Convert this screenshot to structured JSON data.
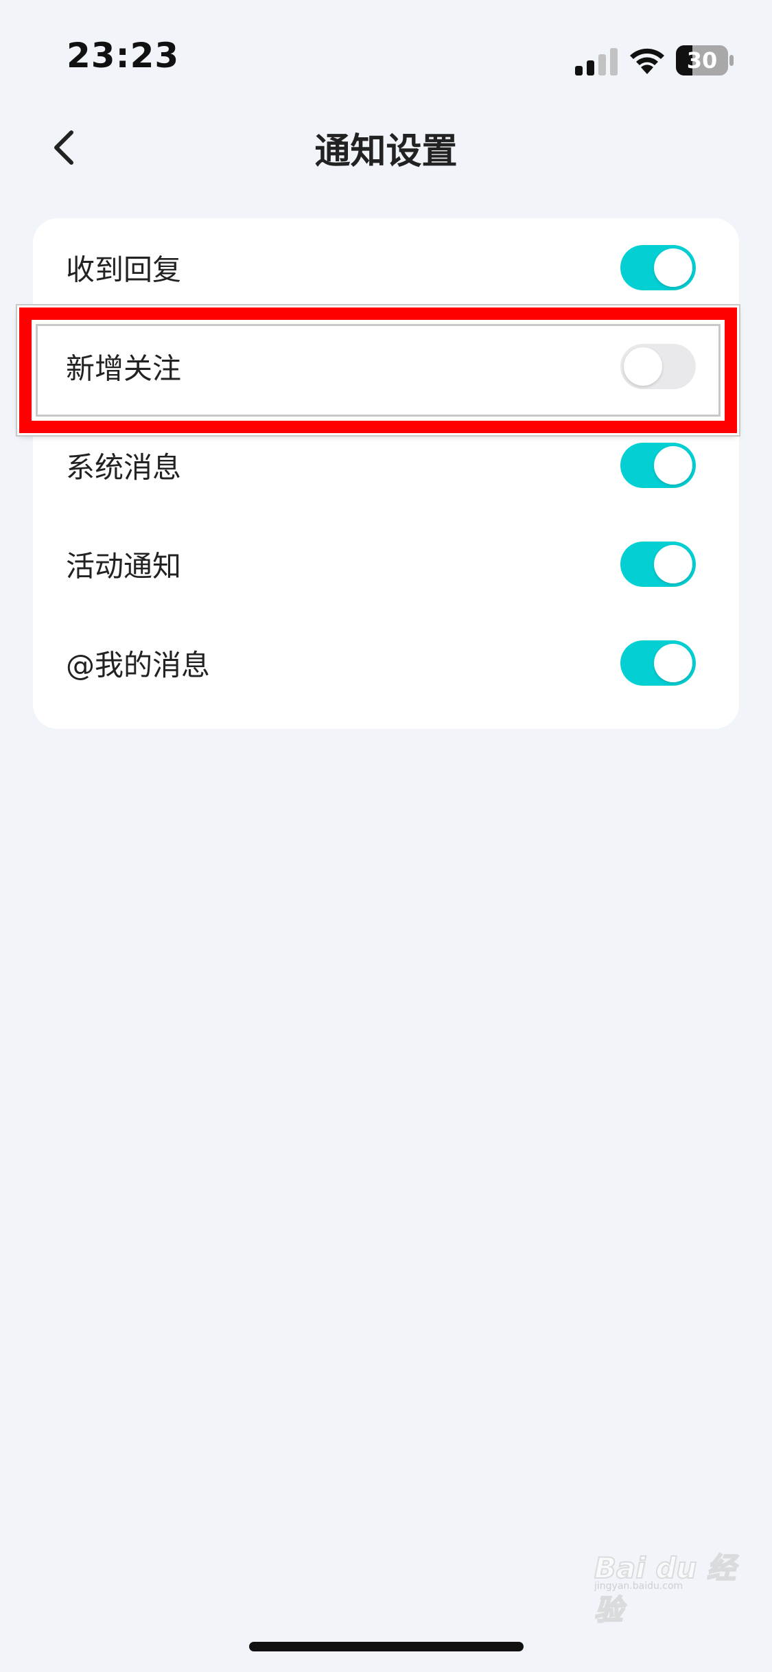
{
  "status_bar": {
    "time": "23:23",
    "battery_level": "30",
    "signal_icon": "cellular-signal-icon",
    "wifi_icon": "wifi-icon"
  },
  "nav": {
    "title": "通知设置",
    "back_icon": "chevron-left-icon"
  },
  "settings": {
    "items": [
      {
        "label": "收到回复",
        "enabled": true
      },
      {
        "label": "新增关注",
        "enabled": false
      },
      {
        "label": "系统消息",
        "enabled": true
      },
      {
        "label": "活动通知",
        "enabled": true
      },
      {
        "label": "@我的消息",
        "enabled": true
      }
    ]
  },
  "colors": {
    "toggle_on": "#04cfd3",
    "toggle_off": "#e9e9eb",
    "highlight": "#ff0000",
    "background": "#f1f4f8"
  },
  "watermark": {
    "brand": "Bai du 经验",
    "url": "jingyan.baidu.com"
  }
}
